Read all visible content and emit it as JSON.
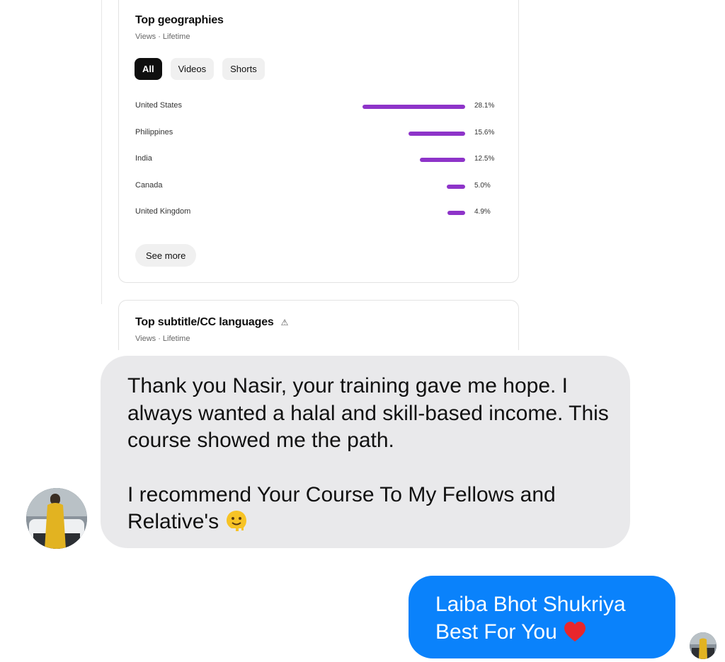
{
  "analytics": {
    "geographies": {
      "title": "Top geographies",
      "subtitle": "Views · Lifetime",
      "filters": [
        {
          "label": "All",
          "active": true
        },
        {
          "label": "Videos",
          "active": false
        },
        {
          "label": "Shorts",
          "active": false
        }
      ],
      "rows": [
        {
          "country": "United States",
          "percent_label": "28.1%",
          "share": 28.1
        },
        {
          "country": "Philippines",
          "percent_label": "15.6%",
          "share": 15.6
        },
        {
          "country": "India",
          "percent_label": "12.5%",
          "share": 12.5
        },
        {
          "country": "Canada",
          "percent_label": "5.0%",
          "share": 5.0
        },
        {
          "country": "United Kingdom",
          "percent_label": "4.9%",
          "share": 4.9
        }
      ],
      "see_more_label": "See more",
      "bar_color": "#8e34c9"
    },
    "cc_languages": {
      "title": "Top subtitle/CC languages",
      "subtitle": "Views · Lifetime",
      "icon": "warning-triangle-icon"
    }
  },
  "chat": {
    "incoming": {
      "paragraph1": "Thank you Nasir, your training gave me hope. I always wanted a halal and skill-based income. This course showed me the path.",
      "paragraph2": "I recommend Your Course To My Fellows and Relative's",
      "emoji": "melting-face-emoji",
      "bubble_color": "#e9e9eb"
    },
    "outgoing": {
      "line1": "Laiba Bhot Shukriya",
      "line2": "Best For You",
      "emoji": "red-heart-emoji",
      "bubble_color": "#0a82fb"
    }
  }
}
